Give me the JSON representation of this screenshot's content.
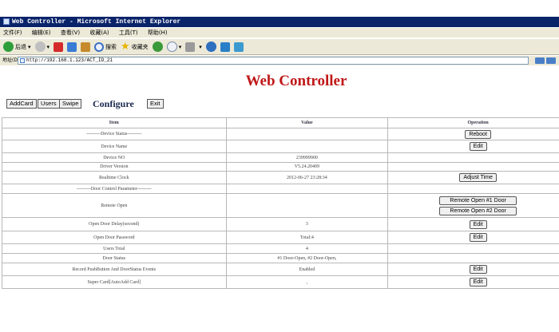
{
  "window": {
    "title": "Web Controller - Microsoft Internet Explorer"
  },
  "menu": [
    "文件(F)",
    "编辑(E)",
    "查看(V)",
    "收藏(A)",
    "工具(T)",
    "帮助(H)"
  ],
  "toolbar": {
    "back_label": "后退",
    "search_label": "搜索",
    "favorites_label": "收藏夹"
  },
  "address": {
    "label": "地址(D)",
    "url": "http://192.168.1.123/ACT_ID_21"
  },
  "page": {
    "heading": "Web Controller",
    "nav": {
      "add_card": "AddCard",
      "users": "Users",
      "swipe": "Swipe",
      "configure": "Configure",
      "exit": "Exit"
    }
  },
  "table": {
    "headers": {
      "item": "Item",
      "value": "Value",
      "operation": "Operation"
    },
    "rows": [
      {
        "item": "---------Device Status---------",
        "value": "",
        "ops": [
          "Reboot"
        ]
      },
      {
        "item": "Device Name",
        "value": "",
        "ops": [
          "Edit"
        ]
      },
      {
        "item": "Device NO",
        "value": "239999900",
        "ops": []
      },
      {
        "item": "Driver Version",
        "value": "V5.24.20409",
        "ops": []
      },
      {
        "item": "Realtime Clock",
        "value": "2012-06-27 23:28:34",
        "ops": [
          "Adjust Time"
        ]
      },
      {
        "item": "---------Door Control Parameter---------",
        "value": "",
        "ops": []
      },
      {
        "item": "Remote Open",
        "value": "",
        "ops": [
          "Remote Open #1 Door",
          "Remote Open #2 Door"
        ]
      },
      {
        "item": "Open Door Delay(second)",
        "value": "3",
        "ops": [
          "Edit"
        ]
      },
      {
        "item": "Open Door Password",
        "value": "Total:4",
        "ops": [
          "Edit"
        ]
      },
      {
        "item": "Users Total",
        "value": "4",
        "ops": []
      },
      {
        "item": "Door Status",
        "value": "#1 Door-Open, #2 Door-Open,",
        "ops": []
      },
      {
        "item": "Record PushButton And DoorStatus Events",
        "value": "Enabled",
        "ops": [
          "Edit"
        ]
      },
      {
        "item": "Super Card[AutoAdd Card]",
        "value": ",",
        "ops": [
          "Edit"
        ]
      }
    ]
  }
}
